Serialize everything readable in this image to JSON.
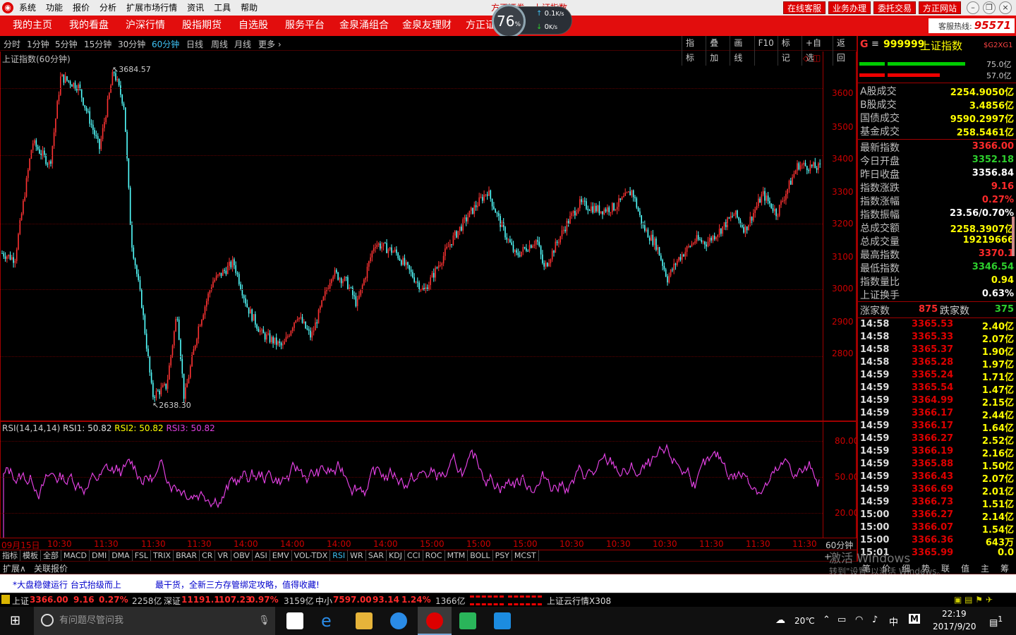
{
  "menubar": {
    "items": [
      "系统",
      "功能",
      "报价",
      "分析",
      "扩展市场行情",
      "资讯",
      "工具",
      "帮助"
    ],
    "title": "方正证券 - 上证指数",
    "buttons": [
      "在线客服",
      "业务办理",
      "委托交易",
      "方正网站"
    ]
  },
  "nav": {
    "items": [
      "我的主页",
      "我的看盘",
      "沪深行情",
      "股指期货",
      "自选股",
      "服务平台",
      "金泉涌组合",
      "金泉友理财",
      "方正证"
    ],
    "hotline_label": "客服热线:",
    "hotline_number": "95571"
  },
  "speed": {
    "percent": "76",
    "unit": "%",
    "up": "0.1",
    "down": "0",
    "unit_speed": "K/s"
  },
  "periods": {
    "items": [
      "分时",
      "1分钟",
      "5分钟",
      "15分钟",
      "30分钟",
      "60分钟",
      "日线",
      "周线",
      "月线",
      "更多"
    ],
    "active": "60分钟"
  },
  "charttools": [
    "指标",
    "叠加",
    "画线",
    "F10",
    "标记",
    "+自选",
    "返回"
  ],
  "chart": {
    "label": "上证指数(60分钟)",
    "high_label": "3684.57",
    "low_label": "2638.30",
    "y_ticks": [
      "3600",
      "3500",
      "3400",
      "3300",
      "3200",
      "3100",
      "3000",
      "2900",
      "2800"
    ],
    "period_label": "60分钟"
  },
  "rsi": {
    "label": "RSI(14,14,14)",
    "rsi1": "RSI1: 50.82",
    "rsi2": "RSI2: 50.82",
    "rsi3": "RSI3: 50.82",
    "y_ticks": [
      "80.00",
      "50.00",
      "20.00"
    ]
  },
  "time_axis": [
    "09月15日",
    "10:30",
    "11:30",
    "11:30",
    "11:30",
    "14:00",
    "14:00",
    "14:00",
    "14:00",
    "15:00",
    "15:00",
    "15:00",
    "10:30",
    "10:30",
    "10:30",
    "11:30",
    "11:30",
    "11:30"
  ],
  "indicators": {
    "items": [
      "指标",
      "模板",
      "全部",
      "MACD",
      "DMI",
      "DMA",
      "FSL",
      "TRIX",
      "BRAR",
      "CR",
      "VR",
      "OBV",
      "ASI",
      "EMV",
      "VOL-TDX",
      "RSI",
      "WR",
      "SAR",
      "KDJ",
      "CCI",
      "ROC",
      "MTM",
      "BOLL",
      "PSY",
      "MCST"
    ],
    "active": "RSI"
  },
  "ext": {
    "expand": "扩展∧",
    "related": "关联报价",
    "plus": "+",
    "tabs": [
      "笔",
      "价",
      "细",
      "势",
      "联",
      "值",
      "主",
      "筹"
    ],
    "watermark1": "激活 Windows",
    "watermark2": "转到\"设置\"以激活 Windows。"
  },
  "stock": {
    "code": "999999",
    "name": "上证指数",
    "tag": "$G2XG1",
    "bar1": "75.0亿",
    "bar2": "57.0亿"
  },
  "turnover": [
    {
      "label": "A股成交",
      "value": "2254.9050亿"
    },
    {
      "label": "B股成交",
      "value": "3.4856亿"
    },
    {
      "label": "国债成交",
      "value": "9590.2997亿"
    },
    {
      "label": "基金成交",
      "value": "258.5461亿"
    }
  ],
  "quote": [
    {
      "label": "最新指数",
      "value": "3366.00",
      "color": "red"
    },
    {
      "label": "今日开盘",
      "value": "3352.18",
      "color": "green"
    },
    {
      "label": "昨日收盘",
      "value": "3356.84",
      "color": "white"
    },
    {
      "label": "指数涨跌",
      "value": "9.16",
      "color": "red"
    },
    {
      "label": "指数涨幅",
      "value": "0.27%",
      "color": "red"
    },
    {
      "label": "指数振幅",
      "value": "23.56/0.70%",
      "color": "white"
    },
    {
      "label": "总成交额",
      "value": "2258.3907亿",
      "color": "yel"
    },
    {
      "label": "总成交量",
      "value": "19219666",
      "color": "yel"
    },
    {
      "label": "最高指数",
      "value": "3370.1",
      "color": "red"
    },
    {
      "label": "最低指数",
      "value": "3346.54",
      "color": "green"
    },
    {
      "label": "指数量比",
      "value": "0.94",
      "color": "yel"
    },
    {
      "label": "上证换手",
      "value": "0.63%",
      "color": "white"
    }
  ],
  "updown": {
    "up_label": "涨家数",
    "up": "875",
    "down_label": "跌家数",
    "down": "375"
  },
  "ticks": [
    [
      "14:58",
      "3365.53",
      "2.40亿"
    ],
    [
      "14:58",
      "3365.33",
      "2.07亿"
    ],
    [
      "14:58",
      "3365.37",
      "1.90亿"
    ],
    [
      "14:58",
      "3365.28",
      "1.97亿"
    ],
    [
      "14:59",
      "3365.24",
      "1.71亿"
    ],
    [
      "14:59",
      "3365.54",
      "1.47亿"
    ],
    [
      "14:59",
      "3364.99",
      "2.15亿"
    ],
    [
      "14:59",
      "3366.17",
      "2.44亿"
    ],
    [
      "14:59",
      "3366.17",
      "1.64亿"
    ],
    [
      "14:59",
      "3366.27",
      "2.52亿"
    ],
    [
      "14:59",
      "3366.19",
      "2.16亿"
    ],
    [
      "14:59",
      "3365.88",
      "1.50亿"
    ],
    [
      "14:59",
      "3366.43",
      "2.07亿"
    ],
    [
      "14:59",
      "3366.69",
      "2.01亿"
    ],
    [
      "14:59",
      "3366.73",
      "1.51亿"
    ],
    [
      "15:00",
      "3366.27",
      "2.14亿"
    ],
    [
      "15:00",
      "3366.07",
      "1.54亿"
    ],
    [
      "15:00",
      "3366.36",
      "643万"
    ],
    [
      "15:01",
      "3365.99",
      "0.0"
    ]
  ],
  "ticker": {
    "a": "*大盘稳健运行  台式抬级而上",
    "b": "最干货，全新三方存管绑定攻略，值得收藏!"
  },
  "status": {
    "sh_name": "上证",
    "sh_val": "3366.00",
    "sh_chg": "9.16",
    "sh_pct": "0.27%",
    "sh_amt": "2258亿",
    "sz_name": "深证",
    "sz_val": "11191.1",
    "sz_chg": "107.23",
    "sz_pct": "0.97%",
    "sz_amt": "3159亿",
    "zx_name": "中小",
    "zx_val": "7597.00",
    "zx_chg": "93.14",
    "zx_pct": "1.24%",
    "zx_amt": "1366亿",
    "cloud": "上证云行情X308"
  },
  "taskbar": {
    "search": "有问题尽管问我",
    "temp": "20℃",
    "lang": "中",
    "ime": "M",
    "time": "22:19",
    "date": "2017/9/20",
    "notif": "1"
  }
}
